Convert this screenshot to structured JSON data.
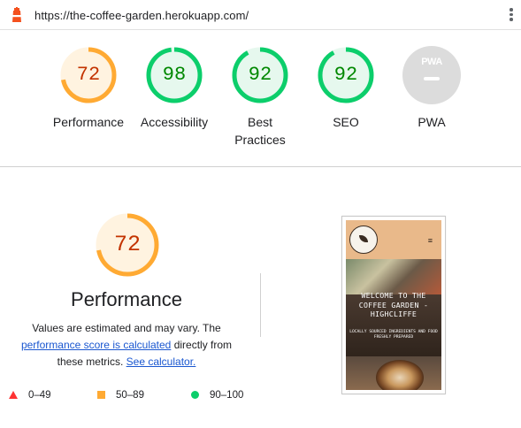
{
  "topbar": {
    "url": "https://the-coffee-garden.herokuapp.com/",
    "logo_icon": "lighthouse-icon",
    "menu_icon": "kebab-menu-icon"
  },
  "colors": {
    "fail": "#ff3333",
    "average": "#ffaa33",
    "pass": "#0cce6b",
    "average_text": "#c33300",
    "pass_text": "#008800",
    "link": "#1a57d0",
    "na": "#dcdcdc"
  },
  "gauges": [
    {
      "score": "72",
      "label": "Performance"
    },
    {
      "score": "98",
      "label": "Accessibility"
    },
    {
      "score": "92",
      "label": "Best\nPractices"
    },
    {
      "score": "92",
      "label": "SEO"
    },
    {
      "score": "",
      "label": "PWA",
      "badge_text": "PWA"
    }
  ],
  "performance": {
    "score": "72",
    "title": "Performance",
    "desc_prefix": "Values are estimated and may vary. The",
    "desc_link": "performance score is calculated",
    "desc_middle": "directly from these metrics.",
    "desc_link2": "See calculator."
  },
  "legend": [
    {
      "icon": "triangle-fail",
      "range": "0–49"
    },
    {
      "icon": "square-average",
      "range": "50–89"
    },
    {
      "icon": "circle-pass",
      "range": "90–100"
    }
  ],
  "screenshot": {
    "welcome": "WELCOME TO THE COFFEE GARDEN - HIGHCLIFFE",
    "tagline": "LOCALLY SOURCED INGREDIENTS AND FOOD FRESHLY PREPARED",
    "menu_glyph": "≡"
  }
}
